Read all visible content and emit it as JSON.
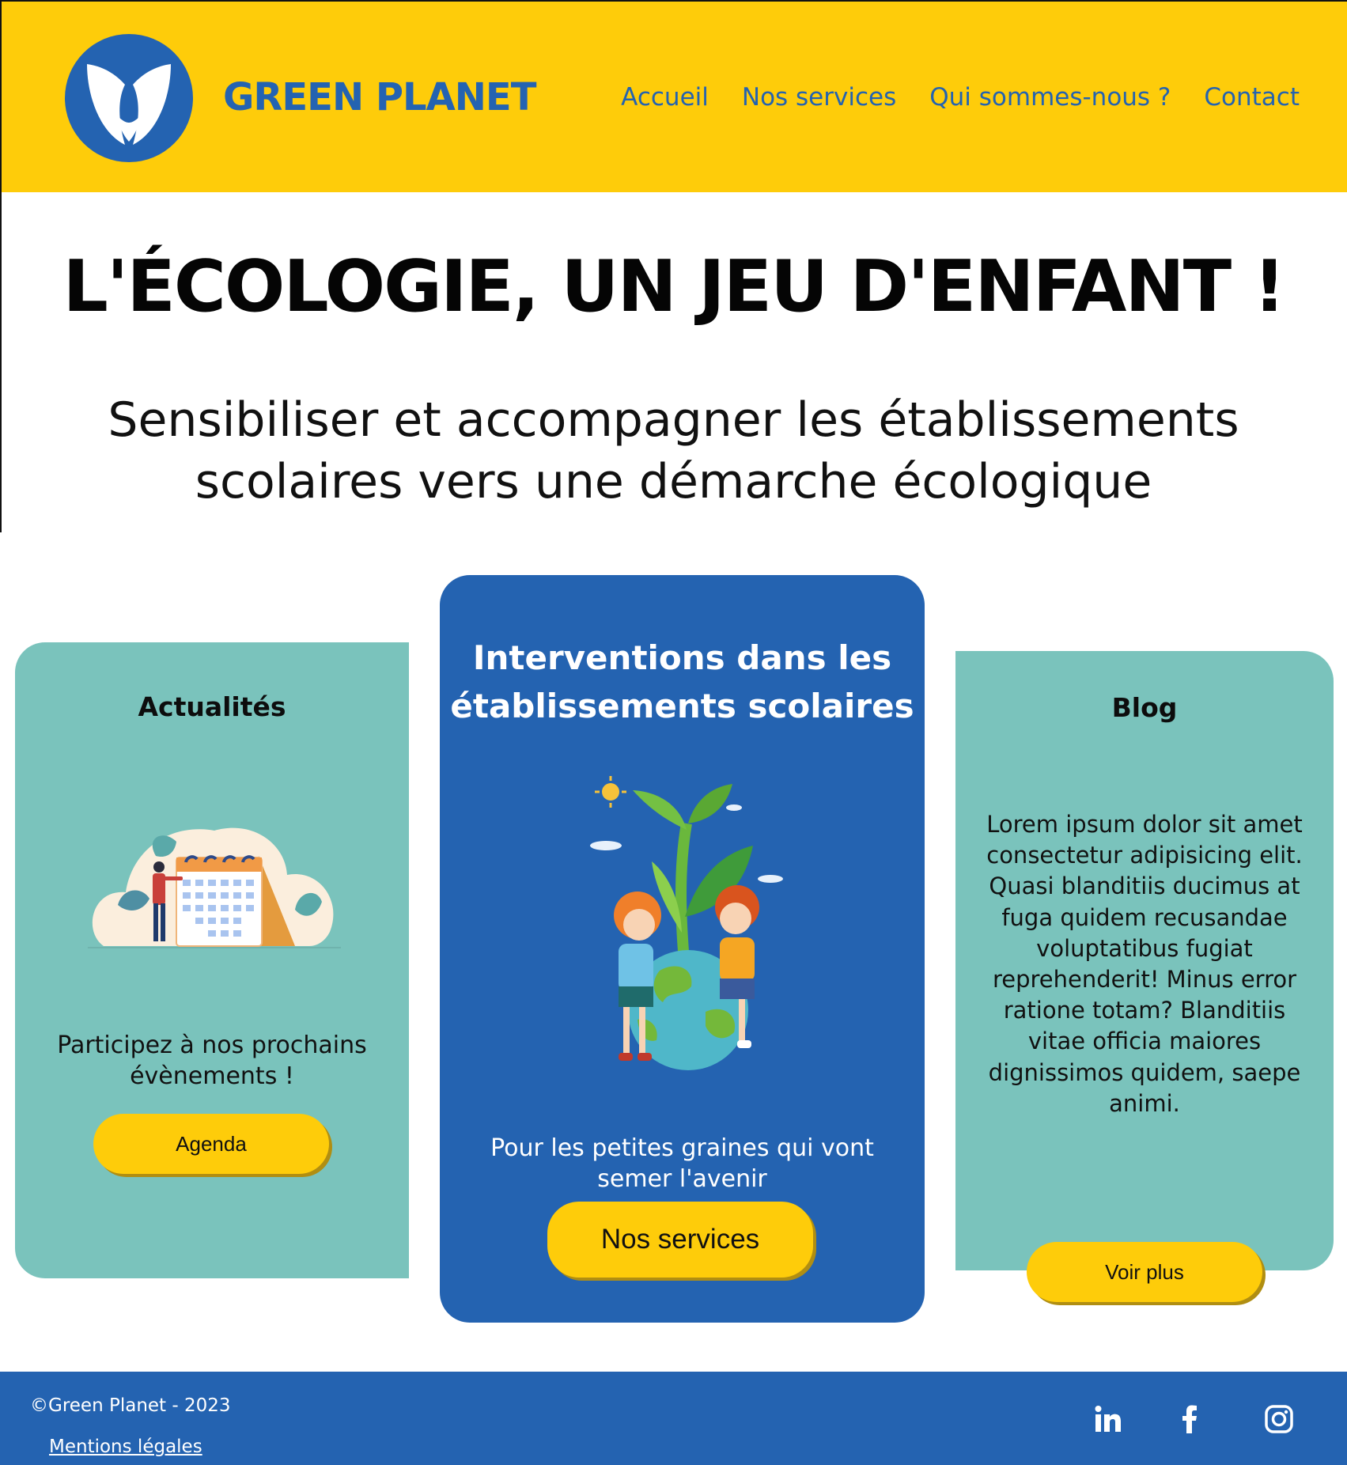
{
  "header": {
    "brand": "GREEN PLANET",
    "nav": [
      "Accueil",
      "Nos services",
      "Qui sommes-nous ?",
      "Contact"
    ]
  },
  "hero": {
    "title": "L'ÉCOLOGIE, UN JEU D'ENFANT !",
    "subtitle_line1": "Sensibiliser et accompagner les établissements",
    "subtitle_line2": "scolaires vers une démarche écologique"
  },
  "cards": {
    "news": {
      "title": "Actualités",
      "text_line1": "Participez à nos prochains",
      "text_line2": "évènements !",
      "button": "Agenda"
    },
    "services": {
      "title_line1": "Interventions dans les",
      "title_line2": "établissements scolaires",
      "text_line1": "Pour les petites graines qui vont",
      "text_line2": "semer l'avenir",
      "button": "Nos services"
    },
    "blog": {
      "title": "Blog",
      "lines": [
        "Lorem ipsum dolor sit amet",
        "consectetur adipisicing elit.",
        "Quasi blanditiis ducimus at",
        "fuga quidem recusandae",
        "voluptatibus fugiat",
        "reprehenderit! Minus error",
        "ratione totam? Blanditiis",
        "vitae officia maiores",
        "dignissimos quidem, saepe",
        "animi."
      ],
      "button": "Voir plus"
    }
  },
  "footer": {
    "copyright": "©Green Planet - 2023",
    "legal": "Mentions légales",
    "social": [
      {
        "icon": "linkedin-icon",
        "label": "in"
      },
      {
        "icon": "facebook-icon",
        "label": "f"
      },
      {
        "icon": "instagram-icon"
      }
    ]
  },
  "colors": {
    "yellow": "#fecc0a",
    "blue": "#2463b1",
    "teal": "#7ac3bc"
  }
}
